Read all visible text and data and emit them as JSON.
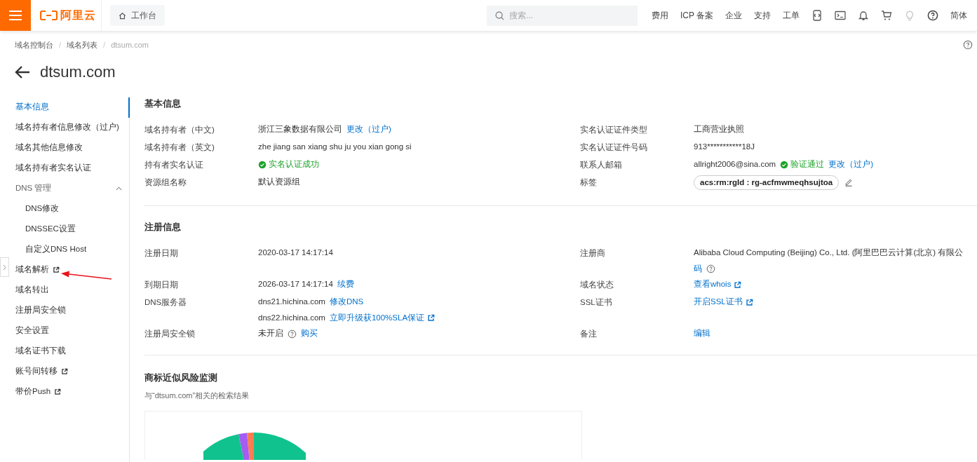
{
  "header": {
    "logo_text": "阿里云",
    "workbench": "工作台",
    "search": {
      "placeholder": "搜索..."
    },
    "nav_links": [
      "费用",
      "ICP 备案",
      "企业",
      "支持",
      "工单"
    ],
    "language": "简体"
  },
  "breadcrumb": {
    "separator": "/",
    "items": [
      {
        "label": "域名控制台",
        "current": false
      },
      {
        "label": "域名列表",
        "current": false
      },
      {
        "label": "dtsum.com",
        "current": true
      }
    ]
  },
  "title": "dtsum.com",
  "sidebar": {
    "items": [
      {
        "label": "基本信息",
        "selected": true,
        "external": false
      },
      {
        "label": "域名持有者信息修改（过户)",
        "selected": false,
        "external": false
      },
      {
        "label": "域名其他信息修改",
        "selected": false,
        "external": false
      },
      {
        "label": "域名持有者实名认证",
        "selected": false,
        "external": false
      },
      {
        "label": "DNS 管理",
        "expanded": true,
        "children": [
          {
            "label": "DNS修改",
            "selected": false,
            "external": false
          },
          {
            "label": "DNSSEC设置",
            "selected": false,
            "external": false
          },
          {
            "label": "自定义DNS Host",
            "selected": false,
            "external": false
          }
        ]
      },
      {
        "label": "域名解析",
        "selected": false,
        "external": true
      },
      {
        "label": "域名转出",
        "selected": false,
        "external": false
      },
      {
        "label": "注册局安全锁",
        "selected": false,
        "external": false
      },
      {
        "label": "安全设置",
        "selected": false,
        "external": false
      },
      {
        "label": "域名证书下载",
        "selected": false,
        "external": false
      },
      {
        "label": "账号间转移",
        "selected": false,
        "external": true
      },
      {
        "label": "带价Push",
        "selected": false,
        "external": true
      }
    ]
  },
  "sections": [
    {
      "title": "基本信息",
      "fields": [
        {
          "label": "域名持有者（中文)",
          "lines": [
            [
              {
                "kind": "text",
                "text": "浙江三象数据有限公司"
              },
              {
                "kind": "link",
                "text": "更改（过户)",
                "external": false
              }
            ]
          ]
        },
        {
          "label": "实名认证证件类型",
          "lines": [
            [
              {
                "kind": "text",
                "text": "工商营业执照"
              }
            ]
          ]
        },
        {
          "label": "域名持有者（英文)",
          "lines": [
            [
              {
                "kind": "text",
                "text": "zhe jiang san xiang shu ju you xian gong si"
              }
            ]
          ]
        },
        {
          "label": "实名认证证件号码",
          "lines": [
            [
              {
                "kind": "text",
                "text": "913***********18J"
              }
            ]
          ]
        },
        {
          "label": "持有者实名认证",
          "lines": [
            [
              {
                "kind": "status",
                "text": "实名认证成功"
              }
            ]
          ]
        },
        {
          "label": "联系人邮箱",
          "lines": [
            [
              {
                "kind": "text",
                "text": "allright2006@sina.com"
              },
              {
                "kind": "status",
                "text": "验证通过"
              },
              {
                "kind": "link",
                "text": "更改（过户)",
                "external": false
              }
            ]
          ]
        },
        {
          "label": "资源组名称",
          "lines": [
            [
              {
                "kind": "text",
                "text": "默认资源组"
              }
            ]
          ]
        },
        {
          "label": "标签",
          "lines": [
            [
              {
                "kind": "tag",
                "text": "acs:rm:rgId : rg-acfmwmeqhsujtoa"
              },
              {
                "kind": "edit"
              }
            ]
          ]
        }
      ]
    },
    {
      "title": "注册信息",
      "fields": [
        {
          "label": "注册日期",
          "lines": [
            [
              {
                "kind": "text",
                "text": "2020-03-17 14:17:14"
              }
            ]
          ]
        },
        {
          "label": "注册商",
          "lines": [
            [
              {
                "kind": "text",
                "text": "Alibaba Cloud Computing (Beijing) Co., Ltd. (阿里巴巴云计算(北京) 有限公"
              }
            ],
            [
              {
                "kind": "link",
                "text": "码",
                "external": false
              },
              {
                "kind": "help"
              }
            ]
          ]
        },
        {
          "label": "到期日期",
          "lines": [
            [
              {
                "kind": "text",
                "text": "2026-03-17 14:17:14"
              },
              {
                "kind": "link",
                "text": "续费",
                "external": false
              }
            ]
          ]
        },
        {
          "label": "域名状态",
          "lines": [
            [
              {
                "kind": "link",
                "text": "查看whois",
                "external": true
              }
            ]
          ]
        },
        {
          "label": "DNS服务器",
          "lines": [
            [
              {
                "kind": "text",
                "text": "dns21.hichina.com"
              },
              {
                "kind": "link",
                "text": "修改DNS",
                "external": false
              }
            ],
            [
              {
                "kind": "text",
                "text": "dns22.hichina.com"
              },
              {
                "kind": "link",
                "text": "立即升级获100%SLA保证",
                "external": true
              }
            ]
          ]
        },
        {
          "label": "SSL证书",
          "lines": [
            [
              {
                "kind": "link",
                "text": "开启SSL证书",
                "external": true
              }
            ]
          ]
        },
        {
          "label": "注册局安全锁",
          "lines": [
            [
              {
                "kind": "text",
                "text": "未开启"
              },
              {
                "kind": "help"
              },
              {
                "kind": "link",
                "text": "购买",
                "external": false
              }
            ]
          ]
        },
        {
          "label": "备注",
          "lines": [
            [
              {
                "kind": "link",
                "text": "编辑",
                "external": false
              }
            ]
          ]
        }
      ]
    },
    {
      "title": "商标近似风险监测",
      "subtitle": "与“dtsum.com”相关的检索结果",
      "kind": "chart"
    }
  ]
}
